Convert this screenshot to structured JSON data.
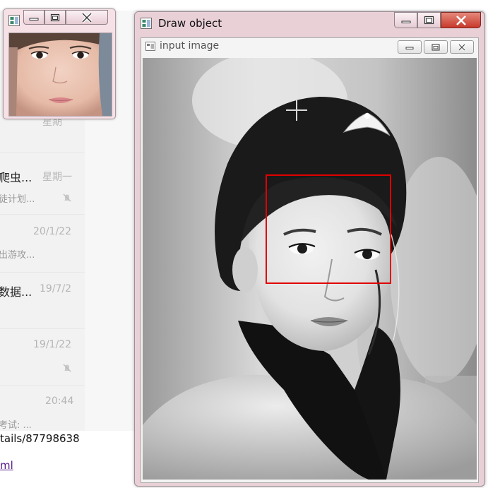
{
  "background": {
    "chat_items": [
      {
        "name": "爬虫...",
        "date": "星期一",
        "preview": "徒计划...",
        "muted": true
      },
      {
        "name": "",
        "date": "20/1/22",
        "preview": "出游攻...",
        "muted": false
      },
      {
        "name": "数据...",
        "date": "19/7/2",
        "preview": "",
        "muted": false
      },
      {
        "name": "",
        "date": "19/1/22",
        "preview": "",
        "muted": true
      },
      {
        "name": "",
        "date": "20:44",
        "preview": "考试: ...",
        "muted": false
      }
    ],
    "partial_date_top": "星期",
    "link_line_1": "tails/87798638",
    "link_line_2": "ml"
  },
  "thumbnail_window": {
    "buttons": [
      "minimize",
      "maximize",
      "close"
    ]
  },
  "main_window": {
    "title": "Draw object",
    "inner_title": "input image",
    "roi_color": "#e00000"
  },
  "icons": {
    "app": "opencv-window-icon",
    "mute": "mute-bell-icon",
    "crosshair": "crosshair-cursor-icon"
  }
}
